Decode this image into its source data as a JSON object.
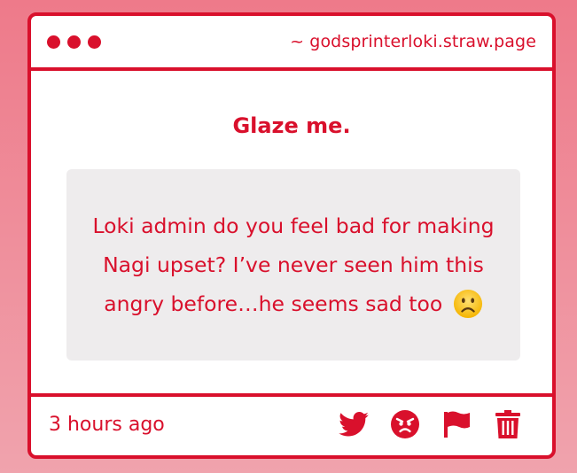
{
  "window": {
    "url": "~ godsprinterloki.straw.page"
  },
  "prompt": {
    "title": "Glaze me."
  },
  "question": {
    "text": "Loki admin do you feel bad for making Nagi upset? I’ve never seen him this angry before…he seems sad too",
    "emoji": "frowning-face"
  },
  "footer": {
    "timestamp": "3 hours ago",
    "icons": [
      "twitter-icon",
      "angry-face-icon",
      "flag-icon",
      "trash-icon"
    ]
  },
  "colors": {
    "accent": "#d9102c",
    "background_top": "#ee7a8a",
    "background_bottom": "#f0a3ad",
    "question_bg": "#eeeced"
  }
}
